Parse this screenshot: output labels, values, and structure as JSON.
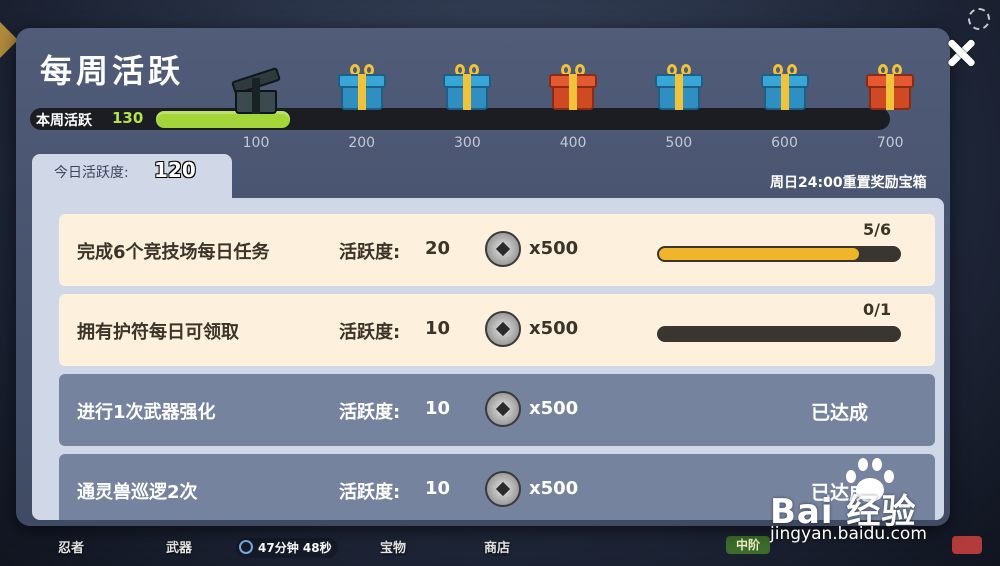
{
  "title": "每周活跃",
  "weekly": {
    "label": "本周活跃",
    "value": "130",
    "progress_fraction": 0.186,
    "milestones": [
      {
        "label": "100",
        "chest": "opened"
      },
      {
        "label": "200",
        "chest": "blue"
      },
      {
        "label": "300",
        "chest": "blue"
      },
      {
        "label": "400",
        "chest": "red"
      },
      {
        "label": "500",
        "chest": "blue"
      },
      {
        "label": "600",
        "chest": "blue"
      },
      {
        "label": "700",
        "chest": "red"
      }
    ]
  },
  "daily": {
    "label": "今日活跃度:",
    "value": "120"
  },
  "reset_note": "周日24:00重置奖励宝箱",
  "tasks": [
    {
      "name": "完成6个竞技场每日任务",
      "activity_label": "活跃度:",
      "activity_value": "20",
      "reward": "x500",
      "progress_text": "5/6",
      "progress_fraction": 0.833
    },
    {
      "name": "拥有护符每日可领取",
      "activity_label": "活跃度:",
      "activity_value": "10",
      "reward": "x500",
      "progress_text": "0/1",
      "progress_fraction": 0
    },
    {
      "name": "进行1次武器强化",
      "activity_label": "活跃度:",
      "activity_value": "10",
      "reward": "x500",
      "status": "已达成"
    },
    {
      "name": "通灵兽巡逻2次",
      "activity_label": "活跃度:",
      "activity_value": "10",
      "reward": "x500",
      "status": "已达成"
    }
  ],
  "background_nav": {
    "items": [
      "忍者",
      "武器",
      "宝物",
      "商店"
    ],
    "timer": "47分钟 48秒",
    "badge": "中阶"
  },
  "watermark": {
    "text": "Bai 经验",
    "url": "jingyan.baidu.com"
  },
  "colors": {
    "weekly_fill": "#a4d63a",
    "task_fill": "#f1b529",
    "pending_row": "#fdf0dc",
    "done_row": "#76839f"
  }
}
